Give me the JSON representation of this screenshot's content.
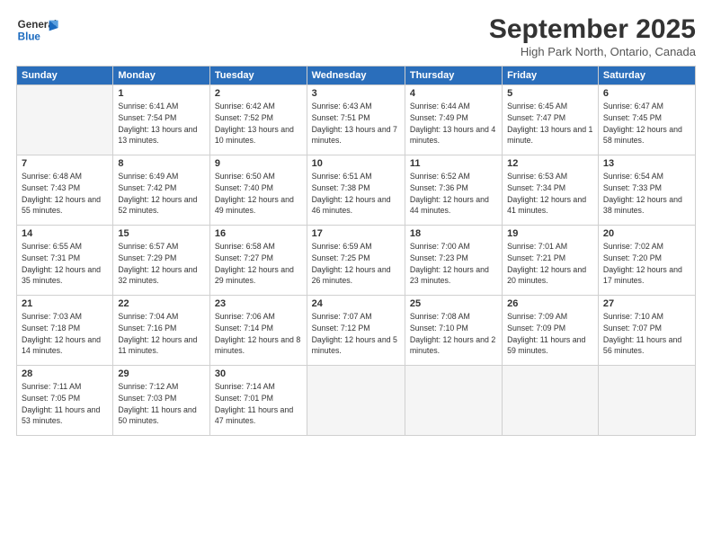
{
  "header": {
    "logo_line1": "General",
    "logo_line2": "Blue",
    "month_title": "September 2025",
    "location": "High Park North, Ontario, Canada"
  },
  "weekdays": [
    "Sunday",
    "Monday",
    "Tuesday",
    "Wednesday",
    "Thursday",
    "Friday",
    "Saturday"
  ],
  "weeks": [
    [
      {
        "day": "",
        "sunrise": "",
        "sunset": "",
        "daylight": ""
      },
      {
        "day": "1",
        "sunrise": "Sunrise: 6:41 AM",
        "sunset": "Sunset: 7:54 PM",
        "daylight": "Daylight: 13 hours and 13 minutes."
      },
      {
        "day": "2",
        "sunrise": "Sunrise: 6:42 AM",
        "sunset": "Sunset: 7:52 PM",
        "daylight": "Daylight: 13 hours and 10 minutes."
      },
      {
        "day": "3",
        "sunrise": "Sunrise: 6:43 AM",
        "sunset": "Sunset: 7:51 PM",
        "daylight": "Daylight: 13 hours and 7 minutes."
      },
      {
        "day": "4",
        "sunrise": "Sunrise: 6:44 AM",
        "sunset": "Sunset: 7:49 PM",
        "daylight": "Daylight: 13 hours and 4 minutes."
      },
      {
        "day": "5",
        "sunrise": "Sunrise: 6:45 AM",
        "sunset": "Sunset: 7:47 PM",
        "daylight": "Daylight: 13 hours and 1 minute."
      },
      {
        "day": "6",
        "sunrise": "Sunrise: 6:47 AM",
        "sunset": "Sunset: 7:45 PM",
        "daylight": "Daylight: 12 hours and 58 minutes."
      }
    ],
    [
      {
        "day": "7",
        "sunrise": "Sunrise: 6:48 AM",
        "sunset": "Sunset: 7:43 PM",
        "daylight": "Daylight: 12 hours and 55 minutes."
      },
      {
        "day": "8",
        "sunrise": "Sunrise: 6:49 AM",
        "sunset": "Sunset: 7:42 PM",
        "daylight": "Daylight: 12 hours and 52 minutes."
      },
      {
        "day": "9",
        "sunrise": "Sunrise: 6:50 AM",
        "sunset": "Sunset: 7:40 PM",
        "daylight": "Daylight: 12 hours and 49 minutes."
      },
      {
        "day": "10",
        "sunrise": "Sunrise: 6:51 AM",
        "sunset": "Sunset: 7:38 PM",
        "daylight": "Daylight: 12 hours and 46 minutes."
      },
      {
        "day": "11",
        "sunrise": "Sunrise: 6:52 AM",
        "sunset": "Sunset: 7:36 PM",
        "daylight": "Daylight: 12 hours and 44 minutes."
      },
      {
        "day": "12",
        "sunrise": "Sunrise: 6:53 AM",
        "sunset": "Sunset: 7:34 PM",
        "daylight": "Daylight: 12 hours and 41 minutes."
      },
      {
        "day": "13",
        "sunrise": "Sunrise: 6:54 AM",
        "sunset": "Sunset: 7:33 PM",
        "daylight": "Daylight: 12 hours and 38 minutes."
      }
    ],
    [
      {
        "day": "14",
        "sunrise": "Sunrise: 6:55 AM",
        "sunset": "Sunset: 7:31 PM",
        "daylight": "Daylight: 12 hours and 35 minutes."
      },
      {
        "day": "15",
        "sunrise": "Sunrise: 6:57 AM",
        "sunset": "Sunset: 7:29 PM",
        "daylight": "Daylight: 12 hours and 32 minutes."
      },
      {
        "day": "16",
        "sunrise": "Sunrise: 6:58 AM",
        "sunset": "Sunset: 7:27 PM",
        "daylight": "Daylight: 12 hours and 29 minutes."
      },
      {
        "day": "17",
        "sunrise": "Sunrise: 6:59 AM",
        "sunset": "Sunset: 7:25 PM",
        "daylight": "Daylight: 12 hours and 26 minutes."
      },
      {
        "day": "18",
        "sunrise": "Sunrise: 7:00 AM",
        "sunset": "Sunset: 7:23 PM",
        "daylight": "Daylight: 12 hours and 23 minutes."
      },
      {
        "day": "19",
        "sunrise": "Sunrise: 7:01 AM",
        "sunset": "Sunset: 7:21 PM",
        "daylight": "Daylight: 12 hours and 20 minutes."
      },
      {
        "day": "20",
        "sunrise": "Sunrise: 7:02 AM",
        "sunset": "Sunset: 7:20 PM",
        "daylight": "Daylight: 12 hours and 17 minutes."
      }
    ],
    [
      {
        "day": "21",
        "sunrise": "Sunrise: 7:03 AM",
        "sunset": "Sunset: 7:18 PM",
        "daylight": "Daylight: 12 hours and 14 minutes."
      },
      {
        "day": "22",
        "sunrise": "Sunrise: 7:04 AM",
        "sunset": "Sunset: 7:16 PM",
        "daylight": "Daylight: 12 hours and 11 minutes."
      },
      {
        "day": "23",
        "sunrise": "Sunrise: 7:06 AM",
        "sunset": "Sunset: 7:14 PM",
        "daylight": "Daylight: 12 hours and 8 minutes."
      },
      {
        "day": "24",
        "sunrise": "Sunrise: 7:07 AM",
        "sunset": "Sunset: 7:12 PM",
        "daylight": "Daylight: 12 hours and 5 minutes."
      },
      {
        "day": "25",
        "sunrise": "Sunrise: 7:08 AM",
        "sunset": "Sunset: 7:10 PM",
        "daylight": "Daylight: 12 hours and 2 minutes."
      },
      {
        "day": "26",
        "sunrise": "Sunrise: 7:09 AM",
        "sunset": "Sunset: 7:09 PM",
        "daylight": "Daylight: 11 hours and 59 minutes."
      },
      {
        "day": "27",
        "sunrise": "Sunrise: 7:10 AM",
        "sunset": "Sunset: 7:07 PM",
        "daylight": "Daylight: 11 hours and 56 minutes."
      }
    ],
    [
      {
        "day": "28",
        "sunrise": "Sunrise: 7:11 AM",
        "sunset": "Sunset: 7:05 PM",
        "daylight": "Daylight: 11 hours and 53 minutes."
      },
      {
        "day": "29",
        "sunrise": "Sunrise: 7:12 AM",
        "sunset": "Sunset: 7:03 PM",
        "daylight": "Daylight: 11 hours and 50 minutes."
      },
      {
        "day": "30",
        "sunrise": "Sunrise: 7:14 AM",
        "sunset": "Sunset: 7:01 PM",
        "daylight": "Daylight: 11 hours and 47 minutes."
      },
      {
        "day": "",
        "sunrise": "",
        "sunset": "",
        "daylight": ""
      },
      {
        "day": "",
        "sunrise": "",
        "sunset": "",
        "daylight": ""
      },
      {
        "day": "",
        "sunrise": "",
        "sunset": "",
        "daylight": ""
      },
      {
        "day": "",
        "sunrise": "",
        "sunset": "",
        "daylight": ""
      }
    ]
  ]
}
